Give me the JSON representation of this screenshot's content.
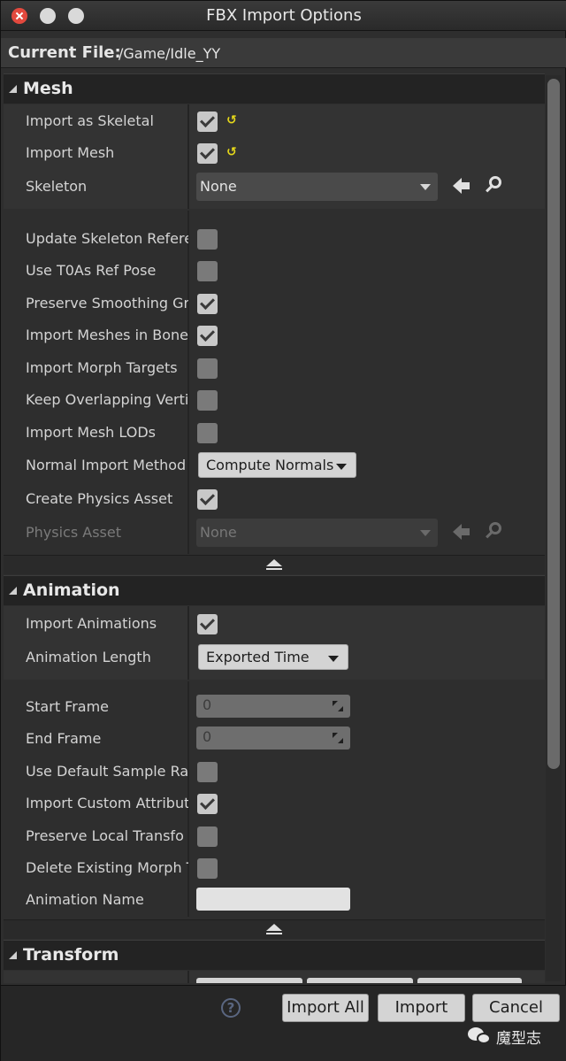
{
  "window": {
    "title": "FBX Import Options"
  },
  "current_file": {
    "label": "Current File:",
    "value": "/Game/Idle_YY"
  },
  "mesh": {
    "header": "Mesh",
    "import_as_skeletal": {
      "label": "Import as Skeletal",
      "checked": true
    },
    "import_mesh": {
      "label": "Import Mesh",
      "checked": true
    },
    "skeleton": {
      "label": "Skeleton",
      "value": "None"
    },
    "update_skeleton_ref": {
      "label": "Update Skeleton Refere",
      "checked": false
    },
    "use_t0_ref_pose": {
      "label": "Use T0As Ref Pose",
      "checked": false
    },
    "preserve_smoothing": {
      "label": "Preserve Smoothing Gr",
      "checked": true
    },
    "import_meshes_in_bone": {
      "label": "Import Meshes in Bone",
      "checked": true
    },
    "import_morph_targets": {
      "label": "Import Morph Targets",
      "checked": false
    },
    "keep_overlapping": {
      "label": "Keep Overlapping Verti",
      "checked": false
    },
    "import_mesh_lods": {
      "label": "Import Mesh LODs",
      "checked": false
    },
    "normal_import_method": {
      "label": "Normal Import Method",
      "value": "Compute Normals"
    },
    "create_physics_asset": {
      "label": "Create Physics Asset",
      "checked": true
    },
    "physics_asset": {
      "label": "Physics Asset",
      "value": "None"
    }
  },
  "animation": {
    "header": "Animation",
    "import_animations": {
      "label": "Import Animations",
      "checked": true
    },
    "animation_length": {
      "label": "Animation Length",
      "value": "Exported Time"
    },
    "start_frame": {
      "label": "Start Frame",
      "value": "0"
    },
    "end_frame": {
      "label": "End Frame",
      "value": "0"
    },
    "use_default_sample_rate": {
      "label": "Use Default Sample Ra",
      "checked": false
    },
    "import_custom_attributes": {
      "label": "Import Custom Attribut",
      "checked": true
    },
    "preserve_local_transform": {
      "label": "Preserve Local Transfo",
      "checked": false
    },
    "delete_existing_morph": {
      "label": "Delete Existing Morph T",
      "checked": false
    },
    "animation_name": {
      "label": "Animation Name",
      "value": ""
    }
  },
  "transform": {
    "header": "Transform"
  },
  "footer": {
    "help": "?",
    "import_all": "Import All",
    "import": "Import",
    "cancel": "Cancel",
    "watermark": "魔型志"
  },
  "icons": {
    "reset": "reset-to-default-icon",
    "use_selected": "arrow-left-icon",
    "browse": "search-icon",
    "advanced": "eject-icon"
  }
}
